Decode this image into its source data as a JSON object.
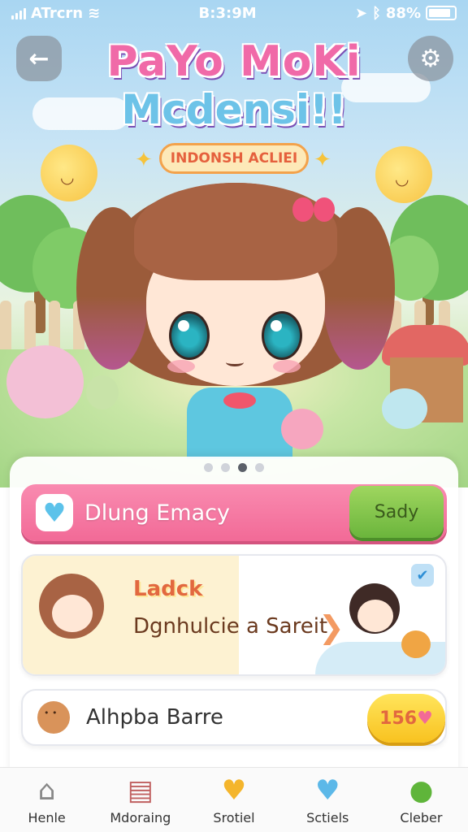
{
  "status_bar": {
    "carrier": "ATrcrn",
    "time": "B:3:9M",
    "battery": "88%"
  },
  "header": {
    "title_line1": "PaYo MoKi",
    "title_line2": "Mcdensi!!",
    "subtitle": "INDONSH ACLIEI",
    "back_icon": "back-arrow-icon",
    "settings_icon": "gear-icon"
  },
  "carousel": {
    "count": 4,
    "active_index": 2
  },
  "panel": {
    "row1": {
      "icon": "heart-icon",
      "label": "Dlung Emacy",
      "button": "Sady"
    },
    "row2": {
      "title": "Ladck",
      "text": "Dgnhulcie a Sareit"
    },
    "row3": {
      "icon": "bear-icon",
      "label": "Alhpba Barre",
      "button": "156"
    }
  },
  "nav": [
    {
      "label": "Henle",
      "icon": "home-icon"
    },
    {
      "label": "Mdoraing",
      "icon": "shop-icon"
    },
    {
      "label": "Srotiel",
      "icon": "heart-icon"
    },
    {
      "label": "Sctiels",
      "icon": "chat-heart-icon"
    },
    {
      "label": "Cleber",
      "icon": "person-icon"
    }
  ],
  "colors": {
    "pink": "#f26a97",
    "green": "#6bb53c",
    "yellow": "#f8c220",
    "sky": "#a9d6f2"
  }
}
